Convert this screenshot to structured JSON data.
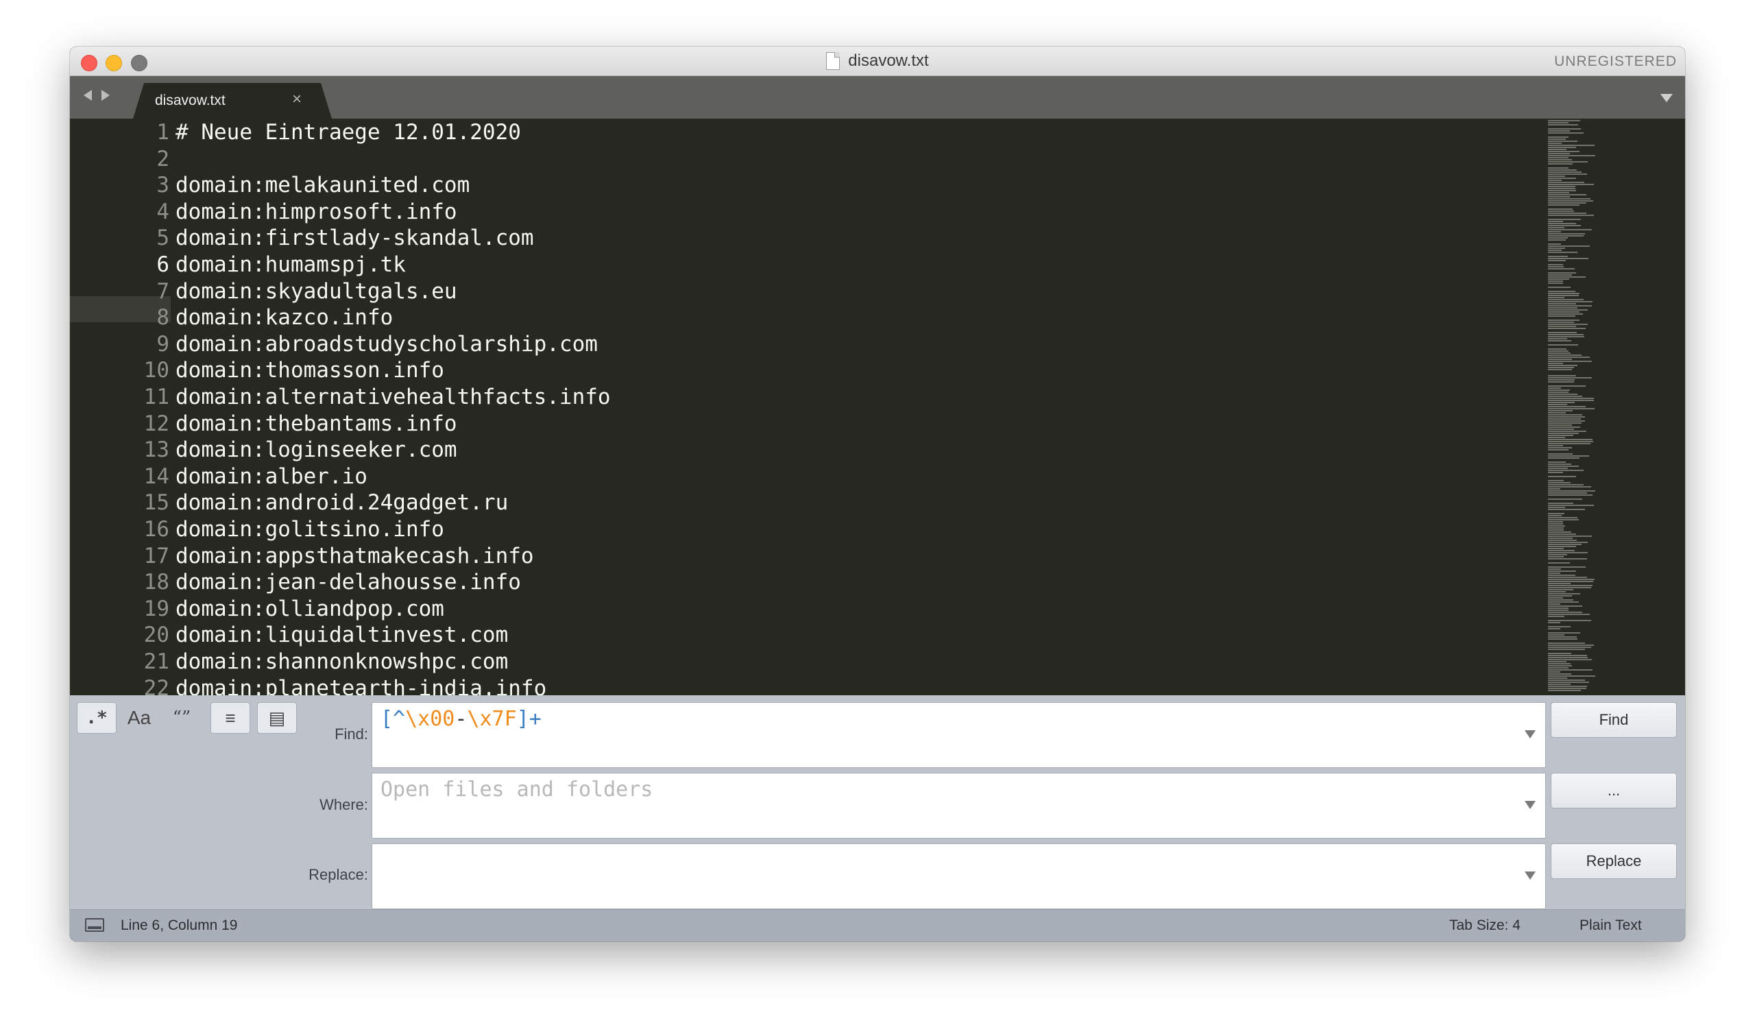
{
  "window": {
    "title": "disavow.txt",
    "license_label": "UNREGISTERED"
  },
  "tabs": [
    {
      "label": "disavow.txt",
      "close": "×"
    }
  ],
  "editor": {
    "current_line": 6,
    "lines": [
      {
        "num": "1",
        "text": "# Neue Eintraege 12.01.2020"
      },
      {
        "num": "2",
        "text": ""
      },
      {
        "num": "3",
        "text": "domain:melakaunited.com"
      },
      {
        "num": "4",
        "text": "domain:himprosoft.info"
      },
      {
        "num": "5",
        "text": "domain:firstlady-skandal.com"
      },
      {
        "num": "6",
        "text": "domain:humamspj.tk"
      },
      {
        "num": "7",
        "text": "domain:skyadultgals.eu"
      },
      {
        "num": "8",
        "text": "domain:kazco.info"
      },
      {
        "num": "9",
        "text": "domain:abroadstudyscholarship.com"
      },
      {
        "num": "10",
        "text": "domain:thomasson.info"
      },
      {
        "num": "11",
        "text": "domain:alternativehealthfacts.info"
      },
      {
        "num": "12",
        "text": "domain:thebantams.info"
      },
      {
        "num": "13",
        "text": "domain:loginseeker.com"
      },
      {
        "num": "14",
        "text": "domain:alber.io"
      },
      {
        "num": "15",
        "text": "domain:android.24gadget.ru"
      },
      {
        "num": "16",
        "text": "domain:golitsino.info"
      },
      {
        "num": "17",
        "text": "domain:appsthatmakecash.info"
      },
      {
        "num": "18",
        "text": "domain:jean-delahousse.info"
      },
      {
        "num": "19",
        "text": "domain:olliandpop.com"
      },
      {
        "num": "20",
        "text": "domain:liquidaltinvest.com"
      },
      {
        "num": "21",
        "text": "domain:shannonknowshpc.com"
      },
      {
        "num": "22",
        "text": "domain:planetearth-india.info"
      }
    ]
  },
  "find_panel": {
    "options": [
      {
        "glyph": ".*",
        "icon": "regex-icon",
        "active": true
      },
      {
        "glyph": "Aa",
        "icon": "case-sensitive-icon",
        "active": false
      },
      {
        "glyph": "“”",
        "icon": "whole-word-icon",
        "active": false
      },
      {
        "glyph": "≡",
        "icon": "show-context-icon",
        "active": true
      },
      {
        "glyph": "▤",
        "icon": "use-buffer-icon",
        "active": true
      }
    ],
    "find_label": "Find:",
    "find_value": {
      "p1": "[^",
      "p2": "\\x00",
      "p3": "-",
      "p4": "\\x7F",
      "p5": "]+"
    },
    "where_label": "Where:",
    "where_placeholder": "Open files and folders",
    "replace_label": "Replace:",
    "replace_value": "",
    "find_button": "Find",
    "more_button": "...",
    "replace_button": "Replace",
    "colors": {
      "regex_bracket": "#3d7fc4",
      "regex_escape": "#f08c1e",
      "regex_dash": "#333333"
    }
  },
  "status": {
    "position": "Line 6, Column 19",
    "tab_size": "Tab Size: 4",
    "syntax": "Plain Text"
  }
}
